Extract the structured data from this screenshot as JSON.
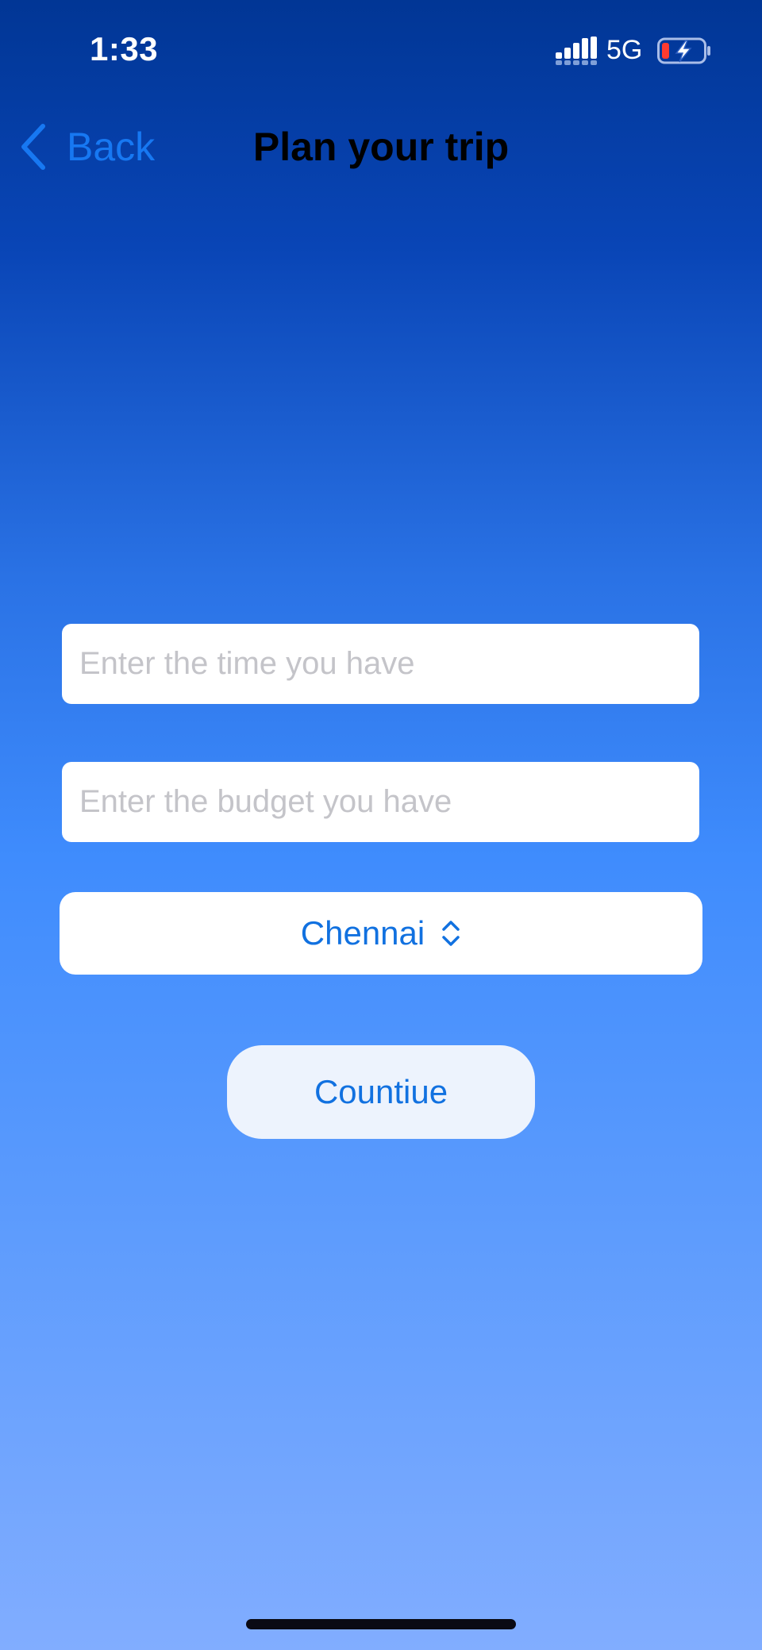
{
  "status_bar": {
    "time": "1:33",
    "network": "5G",
    "signal_icon": "cellular-signal-icon",
    "battery_icon": "battery-charging-low-icon"
  },
  "nav": {
    "back_label": "Back",
    "back_icon": "chevron-left-icon",
    "title": "Plan your trip"
  },
  "form": {
    "time_placeholder": "Enter the time you have",
    "time_value": "",
    "budget_placeholder": "Enter the budget you have",
    "budget_value": "",
    "city_selected": "Chennai",
    "city_icon": "chevron-up-down-icon",
    "continue_label": "Countiue"
  },
  "colors": {
    "accent": "#1778f2",
    "gradient_top": "#013695",
    "gradient_bottom": "#81adff",
    "battery_low": "#ff3b30"
  }
}
